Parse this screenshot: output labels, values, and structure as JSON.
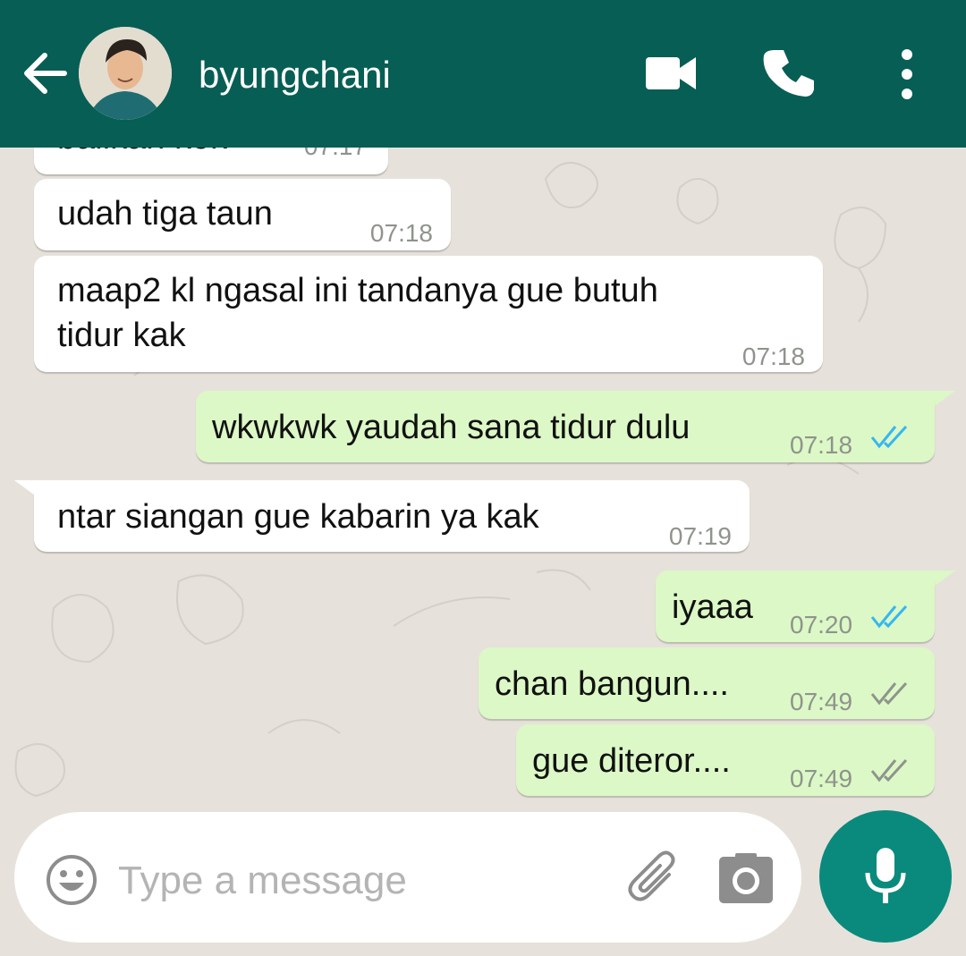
{
  "header": {
    "contact_name": "byungchani",
    "back_icon": "back-arrow-icon",
    "video_icon": "video-call-icon",
    "call_icon": "phone-icon",
    "menu_icon": "more-vertical-icon",
    "color": "#075e54"
  },
  "messages": [
    {
      "direction": "in",
      "text": "balikan kok",
      "time": "07:17"
    },
    {
      "direction": "in",
      "text": "udah tiga taun",
      "time": "07:18"
    },
    {
      "direction": "in",
      "text_line1": "maap2 kl ngasal ini tandanya gue butuh",
      "text_line2": "tidur kak",
      "time": "07:18"
    },
    {
      "direction": "out",
      "text": "wkwkwk yaudah sana tidur dulu",
      "time": "07:18",
      "status": "read"
    },
    {
      "direction": "in",
      "text": "ntar siangan gue kabarin ya kak",
      "time": "07:19"
    },
    {
      "direction": "out",
      "text": "iyaaa",
      "time": "07:20",
      "status": "read"
    },
    {
      "direction": "out",
      "text": "chan bangun....",
      "time": "07:49",
      "status": "delivered"
    },
    {
      "direction": "out",
      "text": "gue diteror....",
      "time": "07:49",
      "status": "delivered"
    }
  ],
  "composer": {
    "placeholder": "Type a message",
    "emoji_icon": "emoji-icon",
    "attach_icon": "paperclip-icon",
    "camera_icon": "camera-icon",
    "mic_icon": "microphone-icon",
    "mic_color": "#098a7c"
  },
  "colors": {
    "incoming_bubble": "#ffffff",
    "outgoing_bubble": "#dcf8c6",
    "read_ticks": "#34b7f1",
    "delivered_ticks": "#8e948c"
  }
}
